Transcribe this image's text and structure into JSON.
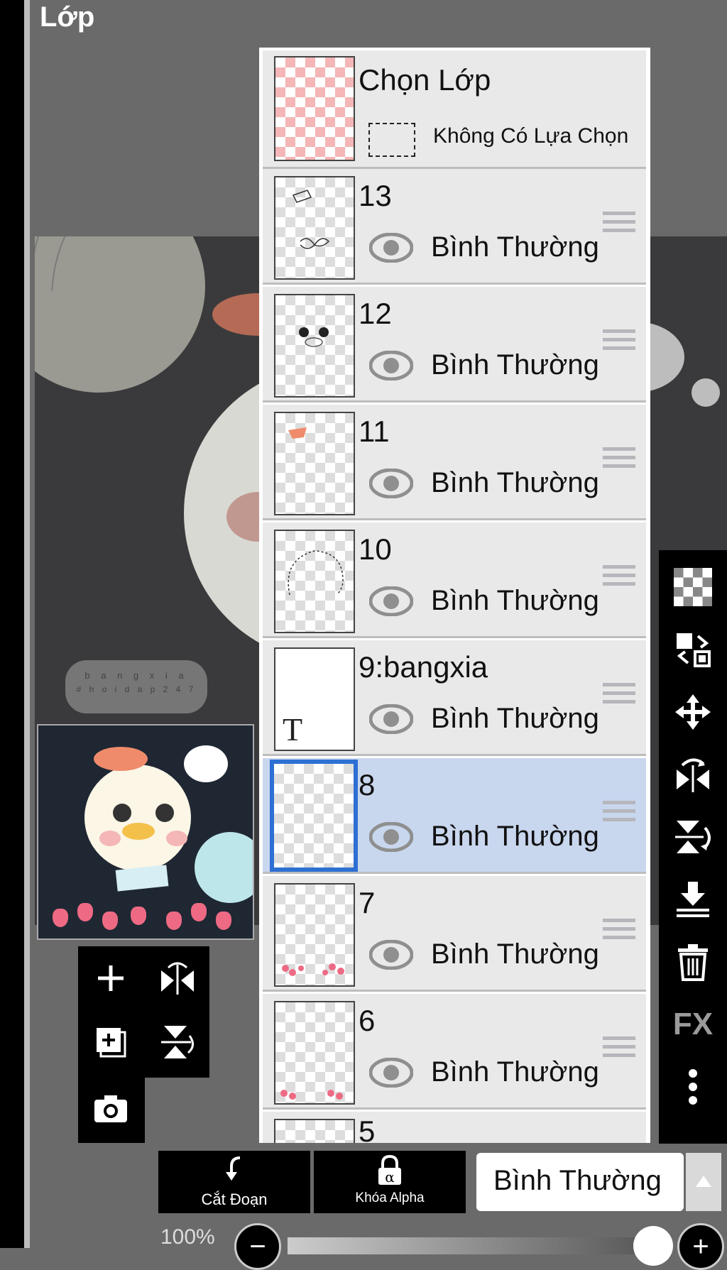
{
  "header": {
    "title": "Lớp"
  },
  "watermark": {
    "line1": "b a n g x i a",
    "line2": "# h o i d a p 2 4 7"
  },
  "selection_row": {
    "title": "Chọn Lớp",
    "status": "Không Có Lựa Chọn"
  },
  "layers": [
    {
      "name": "13",
      "blend": "Bình Thường"
    },
    {
      "name": "12",
      "blend": "Bình Thường"
    },
    {
      "name": "11",
      "blend": "Bình Thường"
    },
    {
      "name": "10",
      "blend": "Bình Thường"
    },
    {
      "name": "9:bangxia",
      "blend": "Bình Thường",
      "thumb_text": "T"
    },
    {
      "name": "8",
      "blend": "Bình Thường",
      "selected": true
    },
    {
      "name": "7",
      "blend": "Bình Thường"
    },
    {
      "name": "6",
      "blend": "Bình Thường"
    },
    {
      "name": "5"
    }
  ],
  "right_toolbar": {
    "icons": [
      "transparency-icon",
      "swap-layer-icon",
      "move-icon",
      "flip-horizontal-icon",
      "flip-vertical-icon",
      "merge-down-icon",
      "trash-icon",
      "fx-icon",
      "more-icon"
    ],
    "fx_label": "FX"
  },
  "left_tools": {
    "icons": [
      "add-layer-icon",
      "add-layer-copy-icon",
      "camera-icon",
      "flip-layer-horizontal-icon",
      "flip-layer-vertical-icon"
    ]
  },
  "bottom_bar": {
    "clipping_label": "Cắt Đoạn",
    "alpha_lock_label": "Khóa Alpha",
    "blend_mode": "Bình Thường",
    "opacity": "100%",
    "minus": "−",
    "plus": "+",
    "alpha_symbol": "α"
  },
  "colors": {
    "panel_bg": "#e9e9e9",
    "selected_row": "#c8d7ee",
    "selected_border": "#2e6fd3",
    "toolbar_bg": "#000000"
  }
}
